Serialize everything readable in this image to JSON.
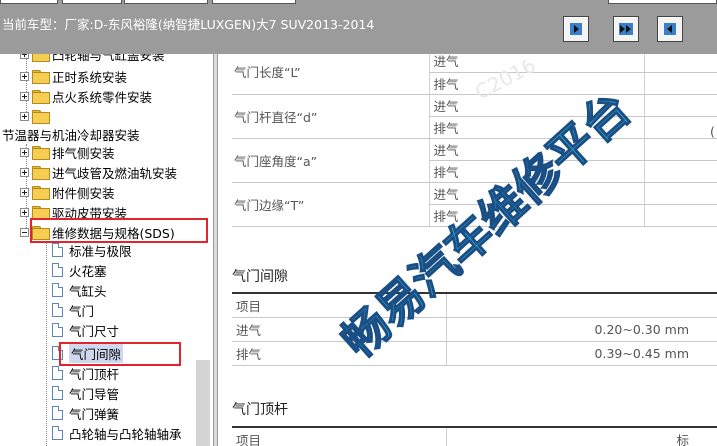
{
  "header": {
    "vehicle_label": "当前车型：",
    "vehicle_name": "厂家:D-东风裕隆(纳智捷LUXGEN)大7 SUV2013-2014"
  },
  "tree": {
    "items": [
      {
        "label": "凸轮轴与气缸盖安装",
        "kind": "folder"
      },
      {
        "label": "正时系统安装",
        "kind": "folder"
      },
      {
        "label": "点火系统零件安装",
        "kind": "folder"
      },
      {
        "label": "",
        "kind": "folder"
      },
      {
        "label": "节温器与机油冷却器安装",
        "kind": "heading"
      },
      {
        "label": "排气侧安装",
        "kind": "folder"
      },
      {
        "label": "进气歧管及燃油轨安装",
        "kind": "folder"
      },
      {
        "label": "附件侧安装",
        "kind": "folder"
      },
      {
        "label": "驱动皮带安装",
        "kind": "folder"
      },
      {
        "label": "维修数据与规格(SDS)",
        "kind": "folder-open"
      },
      {
        "label": "标准与极限",
        "kind": "doc"
      },
      {
        "label": "火花塞",
        "kind": "doc"
      },
      {
        "label": "气缸头",
        "kind": "doc"
      },
      {
        "label": "气门",
        "kind": "doc"
      },
      {
        "label": "气门尺寸",
        "kind": "doc"
      },
      {
        "label": "气门间隙",
        "kind": "doc",
        "selected": true
      },
      {
        "label": "气门顶杆",
        "kind": "doc"
      },
      {
        "label": "气门导管",
        "kind": "doc"
      },
      {
        "label": "气门弹簧",
        "kind": "doc"
      },
      {
        "label": "凸轮轴与凸轮轴轴承",
        "kind": "doc"
      }
    ]
  },
  "spec_table": {
    "rows": [
      {
        "name": "气门长度“L”",
        "sub": [
          "进气",
          "排气"
        ]
      },
      {
        "name": "气门杆直径“d”",
        "sub": [
          "进气",
          "排气"
        ]
      },
      {
        "name": "气门座角度“a”",
        "sub": [
          "进气",
          "排气"
        ]
      },
      {
        "name": "气门边缘“T”",
        "sub": [
          "进气",
          "排气"
        ]
      }
    ],
    "partial_value": "("
  },
  "clearance": {
    "title": "气门间隙",
    "header": "项目",
    "rows": [
      {
        "label": "进气",
        "value": "0.20~0.30 mm"
      },
      {
        "label": "排气",
        "value": "0.39~0.45 mm"
      }
    ]
  },
  "lifter": {
    "title": "气门顶杆",
    "header": "项目",
    "partial_value": "标"
  },
  "watermark": {
    "text": "畅易汽车维修平台",
    "faint_text": "C2016"
  },
  "colors": {
    "header_bg": "#9b9b9b",
    "highlight_box": "#e0262c",
    "watermark_fill": "#39b6d6",
    "watermark_outline": "#1a4f86"
  }
}
